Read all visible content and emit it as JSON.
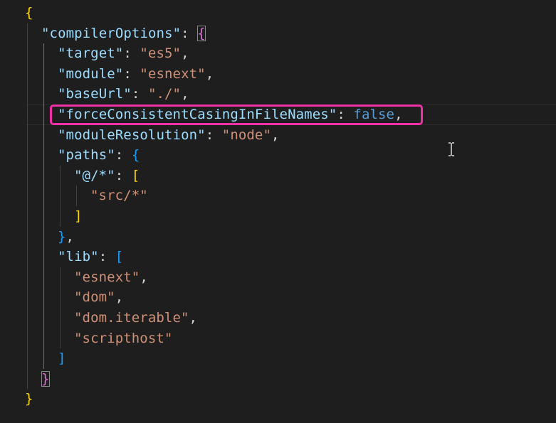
{
  "editor": {
    "current_line": 5,
    "highlighted_line": 5,
    "colors": {
      "highlight_box": "#f030a8",
      "background": "#1e1e1e"
    },
    "lines": [
      {
        "indent": 0,
        "tokens": [
          [
            "{",
            "y"
          ]
        ]
      },
      {
        "indent": 1,
        "tokens": [
          [
            "\"compilerOptions\"",
            "k"
          ],
          [
            ": ",
            "p"
          ],
          [
            "{",
            "m match"
          ]
        ]
      },
      {
        "indent": 2,
        "tokens": [
          [
            "\"target\"",
            "k"
          ],
          [
            ": ",
            "p"
          ],
          [
            "\"es5\"",
            "s"
          ],
          [
            ",",
            "p"
          ]
        ]
      },
      {
        "indent": 2,
        "tokens": [
          [
            "\"module\"",
            "k"
          ],
          [
            ": ",
            "p"
          ],
          [
            "\"esnext\"",
            "s"
          ],
          [
            ",",
            "p"
          ]
        ]
      },
      {
        "indent": 2,
        "tokens": [
          [
            "\"baseUrl\"",
            "k"
          ],
          [
            ": ",
            "p"
          ],
          [
            "\"./\"",
            "s"
          ],
          [
            ",",
            "p"
          ]
        ]
      },
      {
        "indent": 2,
        "tokens": [
          [
            "\"forceConsistentCasingInFileNames\"",
            "k"
          ],
          [
            ": ",
            "p"
          ],
          [
            "false",
            "b"
          ],
          [
            ",",
            "p"
          ]
        ]
      },
      {
        "indent": 2,
        "tokens": [
          [
            "\"moduleResolution\"",
            "k"
          ],
          [
            ": ",
            "p"
          ],
          [
            "\"node\"",
            "s"
          ],
          [
            ",",
            "p"
          ]
        ]
      },
      {
        "indent": 2,
        "tokens": [
          [
            "\"paths\"",
            "k"
          ],
          [
            ": ",
            "p"
          ],
          [
            "{",
            "u"
          ]
        ]
      },
      {
        "indent": 3,
        "tokens": [
          [
            "\"@/*\"",
            "k"
          ],
          [
            ": ",
            "p"
          ],
          [
            "[",
            "y"
          ]
        ]
      },
      {
        "indent": 4,
        "tokens": [
          [
            "\"src/*\"",
            "s"
          ]
        ]
      },
      {
        "indent": 3,
        "tokens": [
          [
            "]",
            "y"
          ]
        ]
      },
      {
        "indent": 2,
        "tokens": [
          [
            "}",
            "u"
          ],
          [
            ",",
            "p"
          ]
        ]
      },
      {
        "indent": 2,
        "tokens": [
          [
            "\"lib\"",
            "k"
          ],
          [
            ": ",
            "p"
          ],
          [
            "[",
            "u"
          ]
        ]
      },
      {
        "indent": 3,
        "tokens": [
          [
            "\"esnext\"",
            "s"
          ],
          [
            ",",
            "p"
          ]
        ]
      },
      {
        "indent": 3,
        "tokens": [
          [
            "\"dom\"",
            "s"
          ],
          [
            ",",
            "p"
          ]
        ]
      },
      {
        "indent": 3,
        "tokens": [
          [
            "\"dom.iterable\"",
            "s"
          ],
          [
            ",",
            "p"
          ]
        ]
      },
      {
        "indent": 3,
        "tokens": [
          [
            "\"scripthost\"",
            "s"
          ]
        ]
      },
      {
        "indent": 2,
        "tokens": [
          [
            "]",
            "u"
          ]
        ]
      },
      {
        "indent": 1,
        "tokens": [
          [
            "}",
            "m match"
          ]
        ]
      },
      {
        "indent": 0,
        "tokens": [
          [
            "}",
            "y"
          ]
        ]
      }
    ]
  }
}
